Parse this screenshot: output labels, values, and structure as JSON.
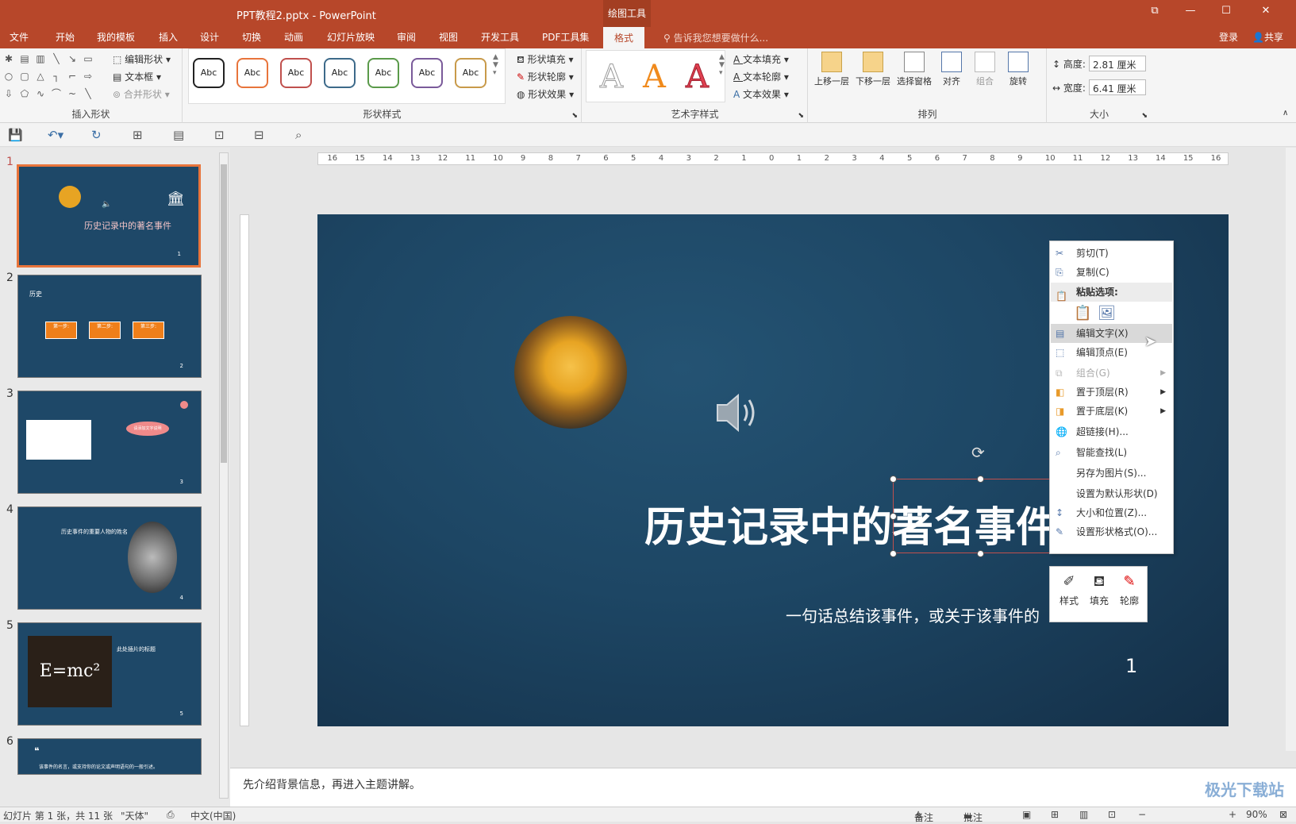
{
  "app": {
    "window_title": "PPT教程2.pptx - PowerPoint",
    "context_tab_group": "绘图工具",
    "login": "登录",
    "share": "共享"
  },
  "tabs": [
    "文件",
    "开始",
    "我的模板",
    "插入",
    "设计",
    "切换",
    "动画",
    "幻灯片放映",
    "审阅",
    "视图",
    "开发工具",
    "PDF工具集",
    "格式"
  ],
  "active_tab": "格式",
  "tell_me": "告诉我您想要做什么...",
  "ribbon": {
    "insert_shapes": {
      "label": "插入形状",
      "edit_shape": "编辑形状",
      "text_box": "文本框",
      "merge_shapes": "合并形状"
    },
    "shape_styles": {
      "label": "形状样式",
      "swatch_text": "Abc",
      "swatch_colors": [
        "#222222",
        "#e8743b",
        "#c0504d",
        "#3d6a8a",
        "#5a9a4a",
        "#7a5a9a",
        "#c89a4a"
      ],
      "fill": "形状填充",
      "outline": "形状轮廓",
      "effects": "形状效果"
    },
    "wordart": {
      "label": "艺术字样式",
      "letter": "A",
      "text_fill": "文本填充",
      "text_outline": "文本轮廓",
      "text_effects": "文本效果"
    },
    "arrange": {
      "label": "排列",
      "bring_forward": "上移一层",
      "send_backward": "下移一层",
      "selection_pane": "选择窗格",
      "align": "对齐",
      "group": "组合",
      "rotate": "旋转"
    },
    "size": {
      "label": "大小",
      "height_label": "高度:",
      "height_value": "2.81 厘米",
      "width_label": "宽度:",
      "width_value": "6.41 厘米"
    }
  },
  "ruler_ticks": [
    "16",
    "15",
    "14",
    "13",
    "12",
    "11",
    "10",
    "9",
    "8",
    "7",
    "6",
    "5",
    "4",
    "3",
    "2",
    "1",
    "0",
    "1",
    "2",
    "3",
    "4",
    "5",
    "6",
    "7",
    "8",
    "9",
    "10",
    "11",
    "12",
    "13",
    "14",
    "15",
    "16"
  ],
  "thumbnails": [
    {
      "num": "1",
      "title": "历史记录中的著名事件",
      "page": "1"
    },
    {
      "num": "2",
      "title": "历史",
      "steps": [
        "第一步:",
        "第二步:",
        "第三步:"
      ],
      "page": "2"
    },
    {
      "num": "3",
      "callout": "请添加文字说明",
      "page": "3"
    },
    {
      "num": "4",
      "title": "历史事件的重要人物的姓名",
      "page": "4"
    },
    {
      "num": "5",
      "title": "此处插片的标题",
      "formula": "E=mc²",
      "page": "5"
    },
    {
      "num": "6",
      "quote": "该事件的名言，或支持你的论文或声明语句的一般引述。"
    }
  ],
  "slide": {
    "title": "历史记录中的著名事件",
    "subtitle": "一句话总结该事件，或关于该事件的",
    "page_number": "1"
  },
  "context_menu": {
    "items": [
      {
        "label": "剪切(T)",
        "icon": "scissors-icon",
        "disabled": false
      },
      {
        "label": "复制(C)",
        "icon": "copy-icon",
        "disabled": false
      },
      {
        "label": "粘贴选项:",
        "icon": "paste-icon",
        "header": true
      },
      {
        "label": "编辑文字(X)",
        "icon": "edit-text-icon",
        "highlighted": true
      },
      {
        "label": "编辑顶点(E)",
        "icon": "edit-points-icon"
      },
      {
        "label": "组合(G)",
        "icon": "group-icon",
        "disabled": true,
        "submenu": true
      },
      {
        "label": "置于顶层(R)",
        "icon": "bring-front-icon",
        "submenu": true
      },
      {
        "label": "置于底层(K)",
        "icon": "send-back-icon",
        "submenu": true
      },
      {
        "label": "超链接(H)...",
        "icon": "link-icon"
      },
      {
        "label": "智能查找(L)",
        "icon": "search-icon"
      },
      {
        "label": "另存为图片(S)...",
        "icon": ""
      },
      {
        "label": "设置为默认形状(D)",
        "icon": ""
      },
      {
        "label": "大小和位置(Z)...",
        "icon": "size-icon"
      },
      {
        "label": "设置形状格式(O)...",
        "icon": "format-shape-icon"
      }
    ]
  },
  "mini_toolbar": {
    "style": "样式",
    "fill": "填充",
    "outline": "轮廓"
  },
  "notes": "先介绍背景信息，再进入主题讲解。",
  "status": {
    "slide_info": "幻灯片 第 1 张，共 11 张",
    "theme": "\"天体\"",
    "language": "中文(中国)",
    "notes_btn": "备注",
    "comments_btn": "批注",
    "zoom": "90%"
  },
  "watermark": "极光下载站"
}
